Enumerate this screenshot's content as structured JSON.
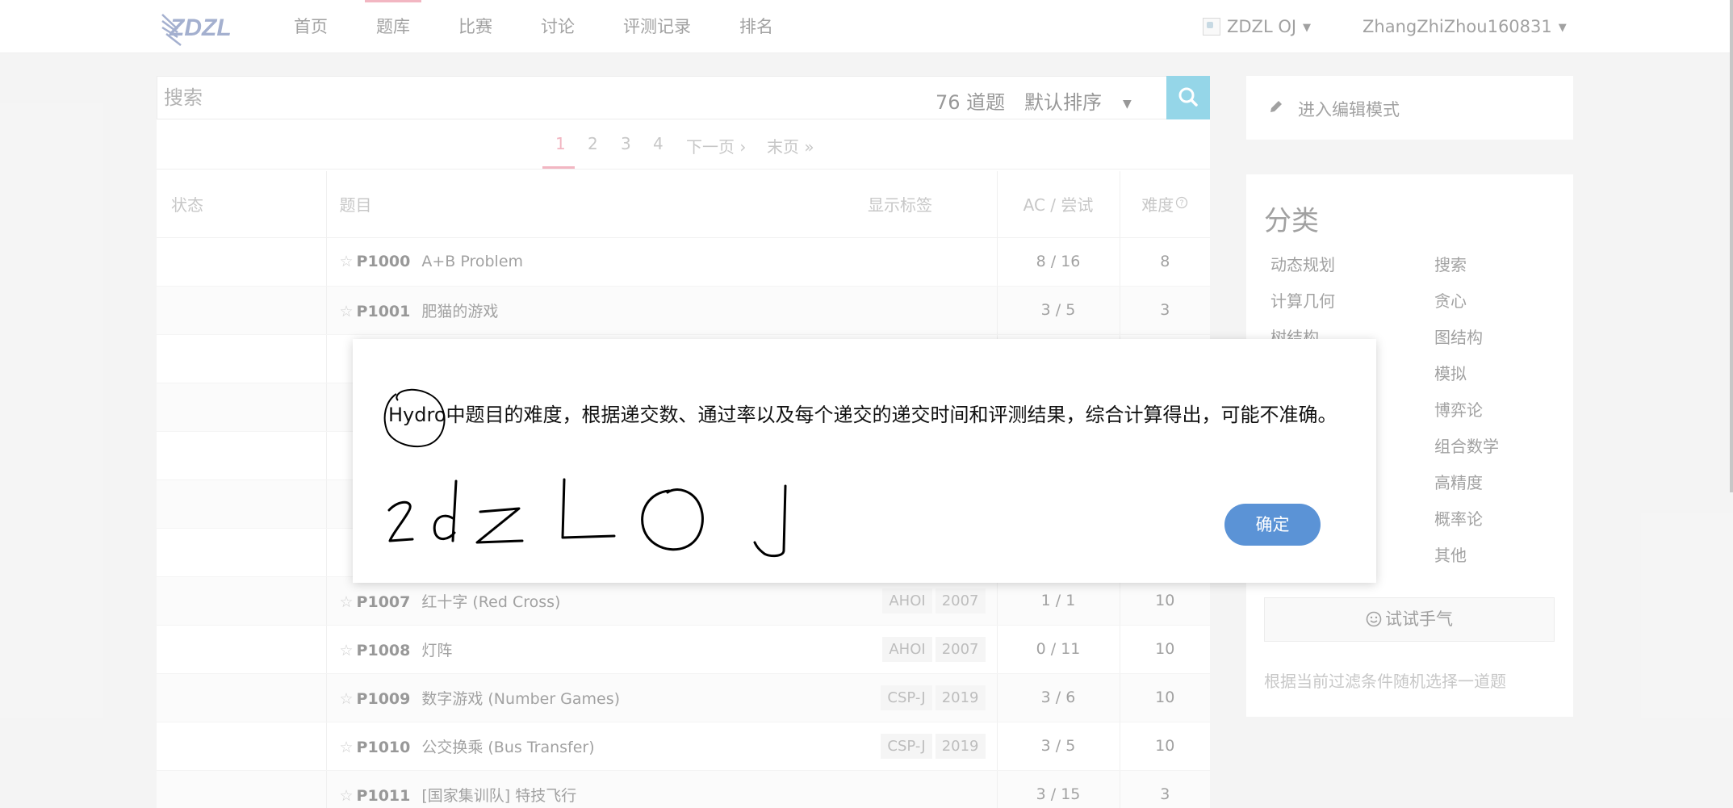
{
  "nav": {
    "items": [
      "首页",
      "题库",
      "比赛",
      "讨论",
      "评测记录",
      "排名"
    ],
    "domain_label": "ZDZL OJ",
    "user_label": "ZhangZhiZhou160831"
  },
  "search": {
    "placeholder": "搜索",
    "count_label": "76 道题",
    "sort_label": "默认排序"
  },
  "pagination": [
    "1",
    "2",
    "3",
    "4",
    "下一页 ›",
    "末页 »"
  ],
  "table": {
    "headers": {
      "status": "状态",
      "title": "题目",
      "tags": "显示标签",
      "ac": "AC / 尝试",
      "difficulty": "难度"
    },
    "rows": [
      {
        "id": "P1000",
        "title": "A+B Problem",
        "tags": [],
        "ac": "8 / 16",
        "difficulty": "8"
      },
      {
        "id": "P1001",
        "title": "肥猫的游戏",
        "tags": [],
        "ac": "3 / 5",
        "difficulty": "3"
      },
      {
        "id": "",
        "title": "",
        "tags": [],
        "ac": "",
        "difficulty": ""
      },
      {
        "id": "",
        "title": "",
        "tags": [],
        "ac": "",
        "difficulty": ""
      },
      {
        "id": "",
        "title": "",
        "tags": [],
        "ac": "",
        "difficulty": ""
      },
      {
        "id": "",
        "title": "",
        "tags": [],
        "ac": "",
        "difficulty": ""
      },
      {
        "id": "",
        "title": "",
        "tags": [],
        "ac": "",
        "difficulty": ""
      },
      {
        "id": "P1007",
        "title": "红十字 (Red Cross)",
        "tags": [
          "AHOI",
          "2007"
        ],
        "ac": "1 / 1",
        "difficulty": "10"
      },
      {
        "id": "P1008",
        "title": "灯阵",
        "tags": [
          "AHOI",
          "2007"
        ],
        "ac": "0 / 11",
        "difficulty": "10"
      },
      {
        "id": "P1009",
        "title": "数字游戏 (Number Games)",
        "tags": [
          "CSP-J",
          "2019"
        ],
        "ac": "3 / 6",
        "difficulty": "10"
      },
      {
        "id": "P1010",
        "title": "公交换乘 (Bus Transfer)",
        "tags": [
          "CSP-J",
          "2019"
        ],
        "ac": "3 / 5",
        "difficulty": "10"
      },
      {
        "id": "P1011",
        "title": "[国家集训队] 特技飞行",
        "tags": [],
        "ac": "3 / 15",
        "difficulty": "3"
      }
    ]
  },
  "sidebar": {
    "edit_label": "进入编辑模式",
    "category_title": "分类",
    "categories_left": [
      "动态规划",
      "计算几何",
      "树结构"
    ],
    "categories_right": [
      "搜索",
      "贪心",
      "图结构",
      "模拟",
      "博弈论",
      "组合数学",
      "高精度",
      "概率论",
      "其他"
    ],
    "try_label": "试试手气",
    "try_note": "根据当前过滤条件随机选择一道题"
  },
  "dialog": {
    "hydro_word": "Hydro",
    "message_rest": "中题目的难度，根据递交数、通过率以及每个递交的递交时间和评测结果，综合计算得出，可能不准确。",
    "ok_label": "确定"
  },
  "colors": {
    "accent_pink": "#e87a91",
    "search_button": "#3fb4d6",
    "ok_button": "#5b93d6"
  }
}
